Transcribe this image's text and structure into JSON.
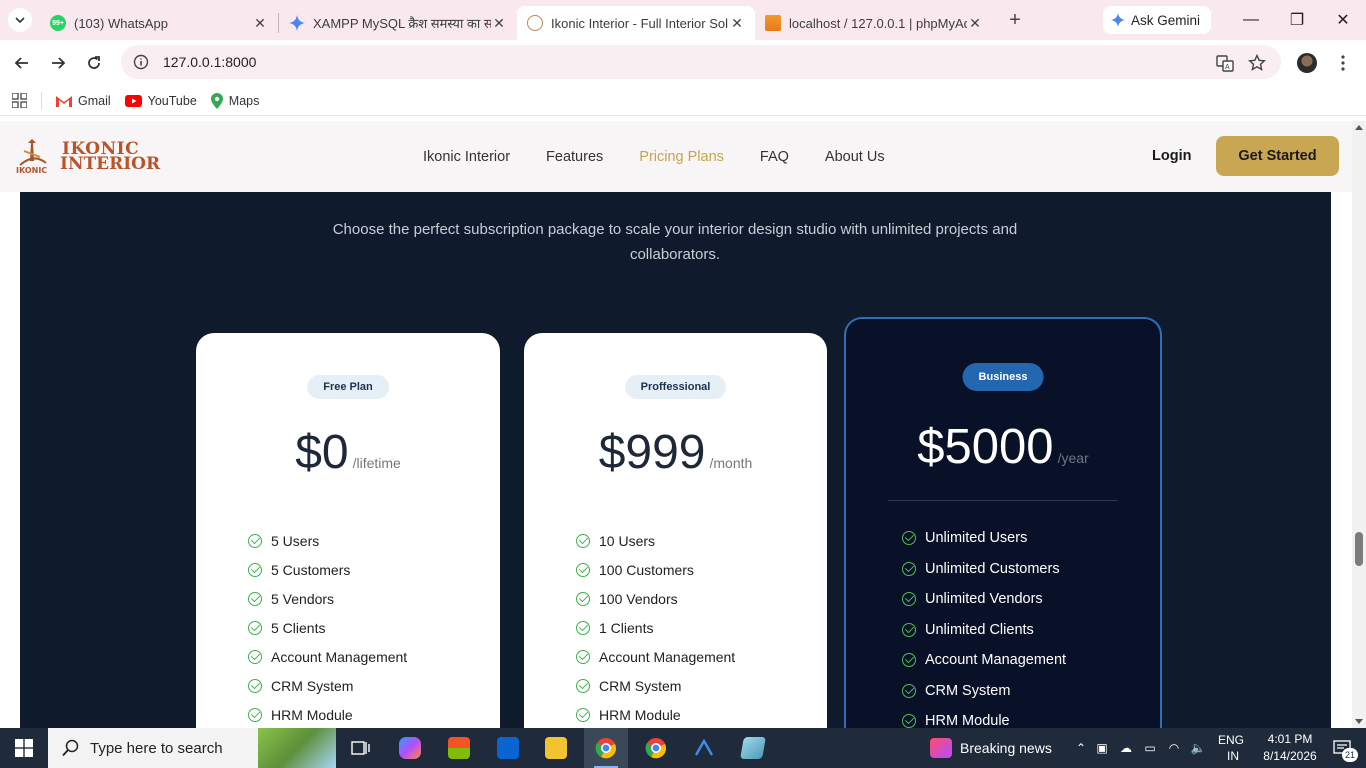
{
  "browser": {
    "tabs": [
      {
        "title": "(103) WhatsApp",
        "badge": "99+"
      },
      {
        "title": "XAMPP MySQL क्रैश समस्या का स"
      },
      {
        "title": "Ikonic Interior - Full Interior Sol"
      },
      {
        "title": "localhost / 127.0.0.1 | phpMyAd"
      }
    ],
    "ask_gemini": "Ask Gemini",
    "url": "127.0.0.1:8000",
    "bookmarks": [
      "Gmail",
      "YouTube",
      "Maps"
    ]
  },
  "site": {
    "logo_line1": "IKONIC",
    "logo_line2": "INTERIOR",
    "logo_small": "IKONIC",
    "nav": [
      "Ikonic Interior",
      "Features",
      "Pricing Plans",
      "FAQ",
      "About Us"
    ],
    "login": "Login",
    "get_started": "Get Started"
  },
  "pricing": {
    "lead": "Choose the perfect subscription package to scale your interior design studio with unlimited projects and collaborators.",
    "plans": [
      {
        "badge": "Free Plan",
        "price": "$0",
        "period": "/lifetime",
        "features": [
          "5 Users",
          "5 Customers",
          "5 Vendors",
          "5 Clients",
          "Account Management",
          "CRM System",
          "HRM Module"
        ]
      },
      {
        "badge": "Proffessional",
        "price": "$999",
        "period": "/month",
        "features": [
          "10 Users",
          "100 Customers",
          "100 Vendors",
          "1 Clients",
          "Account Management",
          "CRM System",
          "HRM Module"
        ]
      },
      {
        "badge": "Business",
        "price": "$5000",
        "period": "/year",
        "features": [
          "Unlimited Users",
          "Unlimited Customers",
          "Unlimited Vendors",
          "Unlimited Clients",
          "Account Management",
          "CRM System",
          "HRM Module"
        ]
      }
    ]
  },
  "taskbar": {
    "search_placeholder": "Type here to search",
    "news": "Breaking news",
    "lang1": "ENG",
    "lang2": "IN",
    "time": "4:01 PM",
    "date": "8/14/2026",
    "notifications": "21"
  },
  "colors": {
    "accent_gold": "#c9a651",
    "section_bg": "#0f1b2d",
    "business_border": "#2f6fb8",
    "check_green": "#3fb04b"
  }
}
